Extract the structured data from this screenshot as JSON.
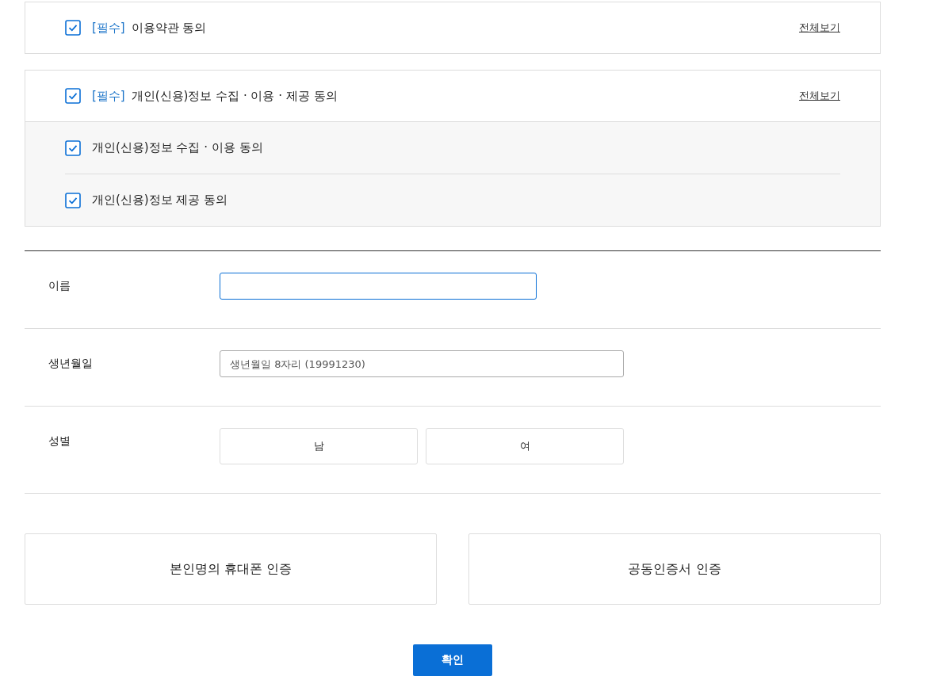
{
  "agreements": [
    {
      "tag": "[필수]",
      "label": "이용약관 동의",
      "checked": true,
      "link": "전체보기"
    },
    {
      "tag": "[필수]",
      "label": "개인(신용)정보 수집 · 이용 · 제공 동의",
      "checked": true,
      "link": "전체보기",
      "children": [
        {
          "label": "개인(신용)정보 수집 · 이용 동의",
          "checked": true
        },
        {
          "label": "개인(신용)정보 제공 동의",
          "checked": true
        }
      ]
    }
  ],
  "form": {
    "rows": [
      {
        "kind": "text",
        "label": "이름",
        "focused": true
      },
      {
        "kind": "text",
        "label": "생년월일",
        "placeholder": "생년월일 8자리 (19991230)",
        "focused": false
      },
      {
        "kind": "choice",
        "label": "성별",
        "options": [
          {
            "label": "남",
            "selected": false
          },
          {
            "label": "여",
            "selected": false
          }
        ]
      }
    ]
  },
  "auth_buttons": [
    "본인명의 휴대폰 인증",
    "공동인증서 인증"
  ],
  "confirm_button": "확인"
}
